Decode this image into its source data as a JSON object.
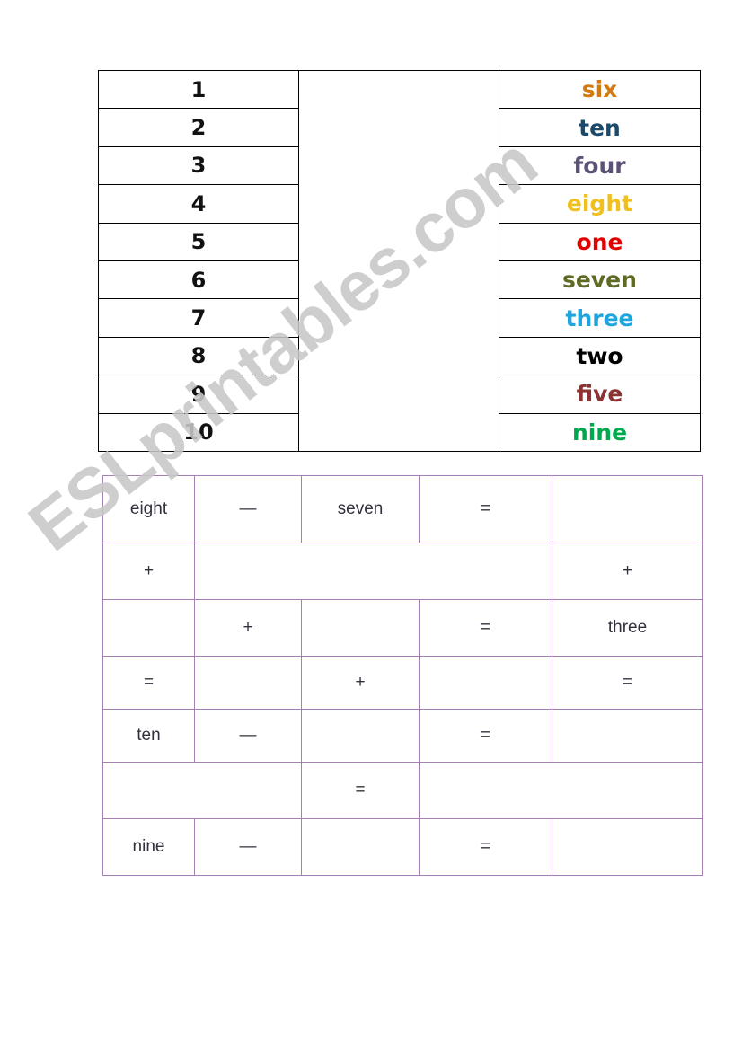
{
  "watermark": {
    "text": "ESLprintables.com"
  },
  "match_table": {
    "numbers": [
      "1",
      "2",
      "3",
      "4",
      "5",
      "6",
      "7",
      "8",
      "9",
      "10"
    ],
    "words": [
      {
        "label": "six",
        "color": "#d2790f"
      },
      {
        "label": "ten",
        "color": "#1b4a6b"
      },
      {
        "label": "four",
        "color": "#5d5275"
      },
      {
        "label": "eight",
        "color": "#f0c020"
      },
      {
        "label": "one",
        "color": "#e00000"
      },
      {
        "label": "seven",
        "color": "#5f6b24"
      },
      {
        "label": "three",
        "color": "#1fa5dd"
      },
      {
        "label": "two",
        "color": "#000000"
      },
      {
        "label": "five",
        "color": "#8b3232"
      },
      {
        "label": "nine",
        "color": "#00a84f"
      }
    ],
    "middle_column": [
      "",
      "",
      "",
      "",
      "",
      "",
      "",
      "",
      "",
      ""
    ]
  },
  "exercise_table": {
    "border_color": "#a87fb4",
    "rows": [
      {
        "cells": [
          {
            "text": "eight",
            "span": 1
          },
          {
            "text": "—",
            "span": 1
          },
          {
            "text": "seven",
            "span": 1
          },
          {
            "text": "=",
            "span": 1
          },
          {
            "text": "",
            "span": 1
          }
        ]
      },
      {
        "cells": [
          {
            "text": "+",
            "span": 1
          },
          {
            "text": "",
            "span": 3
          },
          {
            "text": "+",
            "span": 1
          }
        ]
      },
      {
        "cells": [
          {
            "text": "",
            "span": 1
          },
          {
            "text": "+",
            "span": 1
          },
          {
            "text": "",
            "span": 1
          },
          {
            "text": "=",
            "span": 1
          },
          {
            "text": "three",
            "span": 1
          }
        ]
      },
      {
        "cells": [
          {
            "text": "=",
            "span": 1
          },
          {
            "text": "",
            "span": 1
          },
          {
            "text": "+",
            "span": 1
          },
          {
            "text": "",
            "span": 1
          },
          {
            "text": "=",
            "span": 1
          }
        ]
      },
      {
        "cells": [
          {
            "text": "ten",
            "span": 1
          },
          {
            "text": "—",
            "span": 1
          },
          {
            "text": "",
            "span": 1
          },
          {
            "text": "=",
            "span": 1
          },
          {
            "text": "",
            "span": 1
          }
        ]
      },
      {
        "cells": [
          {
            "text": "",
            "span": 2
          },
          {
            "text": "=",
            "span": 1
          },
          {
            "text": "",
            "span": 2
          }
        ]
      },
      {
        "cells": [
          {
            "text": "nine",
            "span": 1
          },
          {
            "text": "—",
            "span": 1
          },
          {
            "text": "",
            "span": 1
          },
          {
            "text": "=",
            "span": 1
          },
          {
            "text": "",
            "span": 1
          }
        ]
      }
    ]
  }
}
